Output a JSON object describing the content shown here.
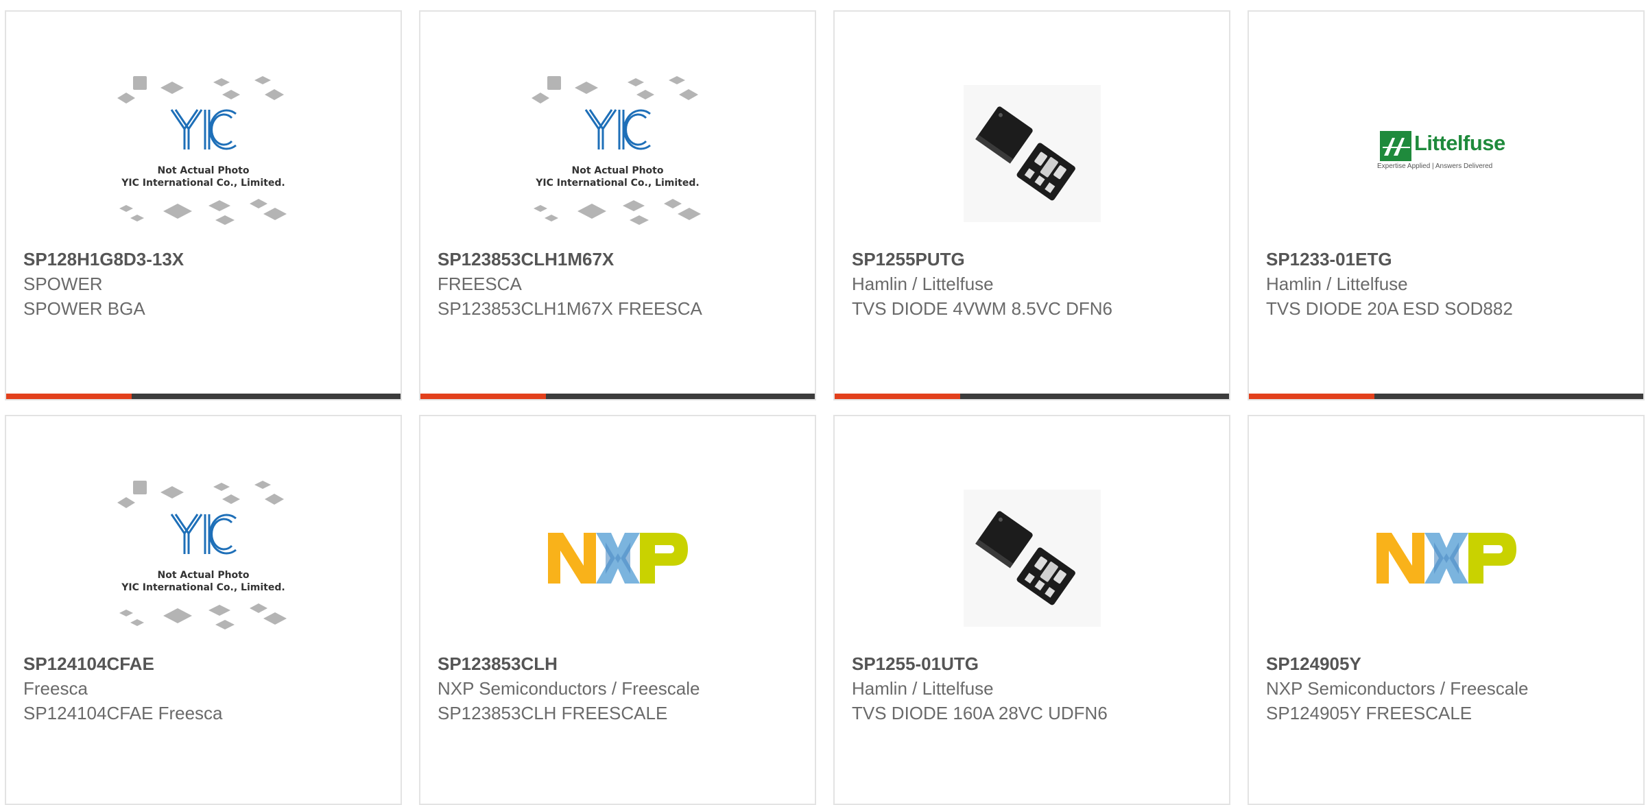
{
  "products": [
    {
      "part_number": "SP128H1G8D3-13X",
      "manufacturer": "SPOWER",
      "description": "SPOWER BGA",
      "image": "yic-placeholder",
      "image_text": [
        "Not Actual Photo",
        "YIC International Co., Limited."
      ]
    },
    {
      "part_number": "SP123853CLH1M67X",
      "manufacturer": "FREESCA",
      "description": "SP123853CLH1M67X FREESCA",
      "image": "yic-placeholder",
      "image_text": [
        "Not Actual Photo",
        "YIC International Co., Limited."
      ]
    },
    {
      "part_number": "SP1255PUTG",
      "manufacturer": "Hamlin / Littelfuse",
      "description": "TVS DIODE 4VWM 8.5VC DFN6",
      "image": "dfn-chip-photo"
    },
    {
      "part_number": "SP1233-01ETG",
      "manufacturer": "Hamlin / Littelfuse",
      "description": "TVS DIODE 20A ESD SOD882",
      "image": "littelfuse-logo",
      "image_text": [
        "Littelfuse",
        "Expertise Applied | Answers Delivered"
      ]
    },
    {
      "part_number": "SP124104CFAE",
      "manufacturer": "Freesca",
      "description": "SP124104CFAE Freesca",
      "image": "yic-placeholder",
      "image_text": [
        "Not Actual Photo",
        "YIC International Co., Limited."
      ]
    },
    {
      "part_number": "SP123853CLH",
      "manufacturer": "NXP Semiconductors / Freescale",
      "description": "SP123853CLH FREESCALE",
      "image": "nxp-logo"
    },
    {
      "part_number": "SP1255-01UTG",
      "manufacturer": "Hamlin / Littelfuse",
      "description": "TVS DIODE 160A 28VC UDFN6",
      "image": "dfn-chip-photo"
    },
    {
      "part_number": "SP124905Y",
      "manufacturer": "NXP Semiconductors / Freescale",
      "description": "SP124905Y FREESCALE",
      "image": "nxp-logo"
    }
  ],
  "colors": {
    "accent": "#e2401c",
    "bar": "#3c3c3c",
    "border": "#e3e3e3",
    "yic_blue": "#1e6fb8",
    "littelfuse_green": "#1f8a3c",
    "nxp_orange": "#f9b21a",
    "nxp_blue": "#7bb4de",
    "nxp_green": "#c9d200"
  }
}
